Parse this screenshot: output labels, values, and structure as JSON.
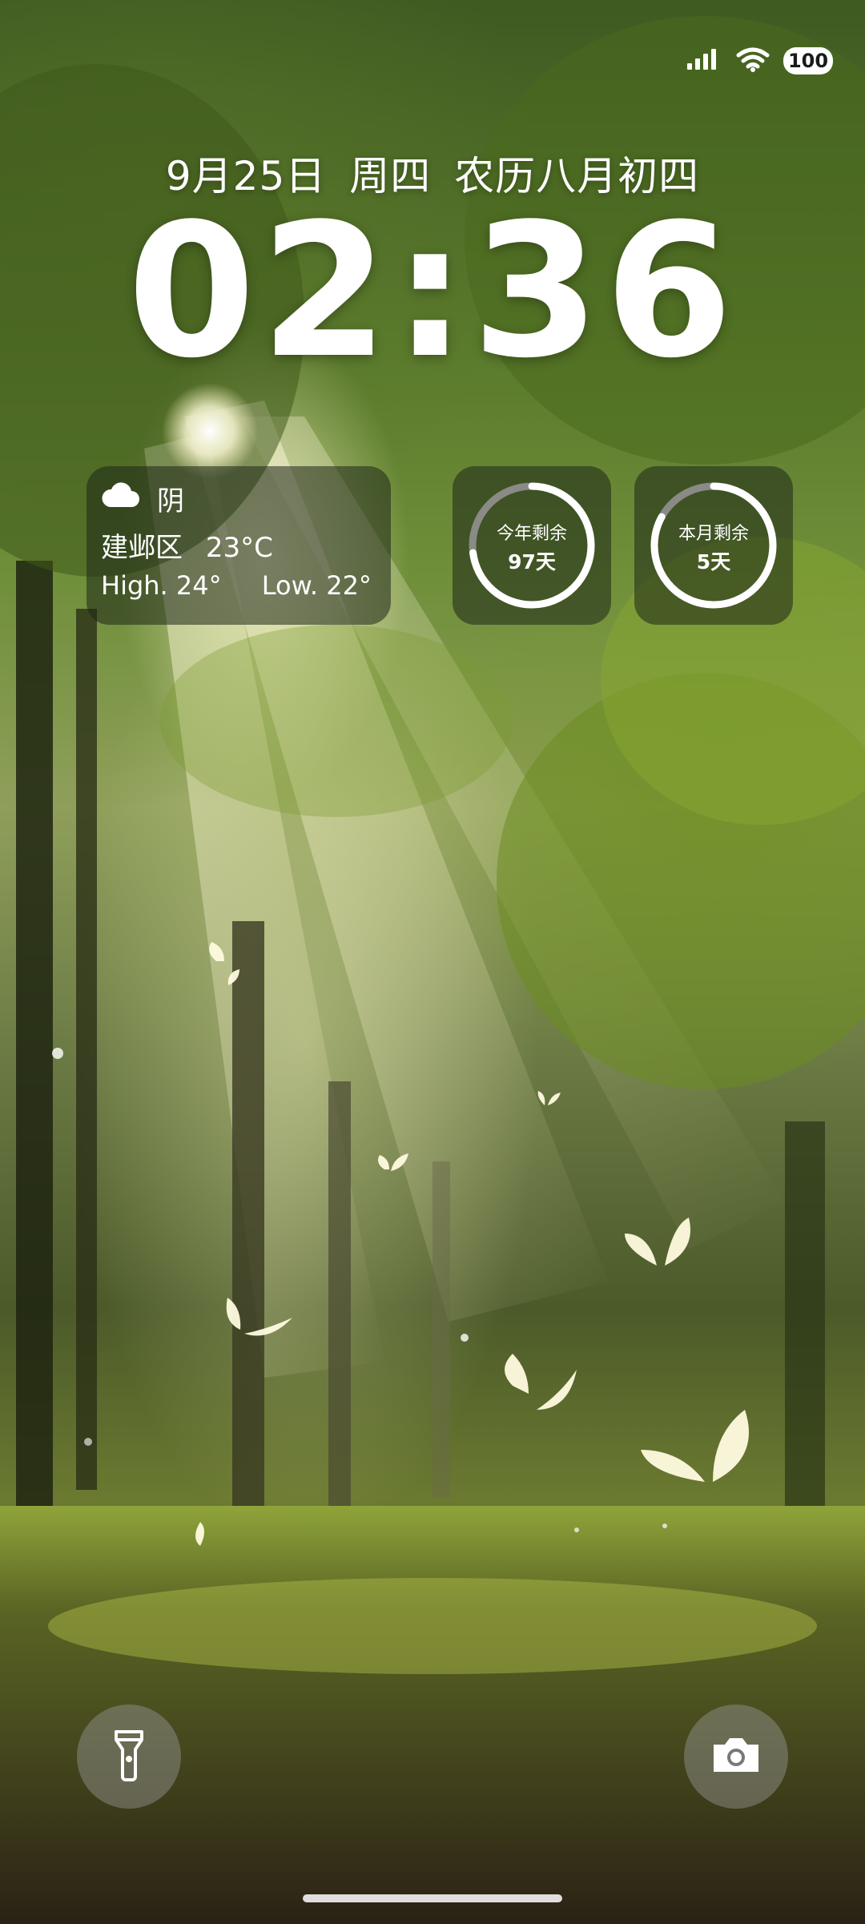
{
  "status_bar": {
    "battery": "100",
    "signal_icon": "cellular-signal-icon",
    "wifi_icon": "wifi-icon"
  },
  "lock_screen": {
    "date": "9月25日",
    "weekday": "周四",
    "lunar_date": "农历八月初四",
    "time": "02:36"
  },
  "weather_widget": {
    "icon": "cloud-icon",
    "condition": "阴",
    "location": "建邺区",
    "temperature": "23°C",
    "high": "High. 24°",
    "low": "Low. 22°"
  },
  "countdown_widgets": [
    {
      "label": "今年剩余",
      "value": "97天",
      "progress_remaining": 0.73
    },
    {
      "label": "本月剩余",
      "value": "5天",
      "progress_remaining": 0.83
    }
  ],
  "shortcuts": {
    "left_icon": "flashlight-icon",
    "right_icon": "camera-icon"
  },
  "colors": {
    "ring_track": "#8a8a86",
    "ring_fill": "#ffffff",
    "widget_bg": "#1e2618"
  }
}
